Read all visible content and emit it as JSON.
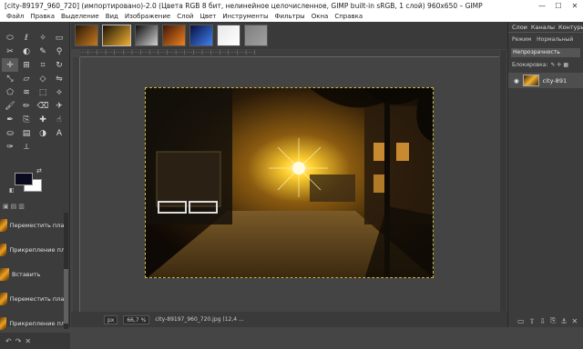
{
  "window": {
    "title": "[city-89197_960_720] (импортировано)-2.0 (Цвета RGB 8 бит, нелинейное целочисленное, GIMP built-in sRGB, 1 слой) 960x650 – GIMP",
    "minimize": "—",
    "maximize": "☐",
    "close": "✕"
  },
  "menu": [
    "Файл",
    "Правка",
    "Выделение",
    "Вид",
    "Изображение",
    "Слой",
    "Цвет",
    "Инструменты",
    "Фильтры",
    "Окна",
    "Справка"
  ],
  "tools": [
    {
      "icon": "ellipse-select-icon",
      "glyph": "⬭"
    },
    {
      "icon": "lasso-icon",
      "glyph": "ℓ"
    },
    {
      "icon": "fuzzy-select-icon",
      "glyph": "✧"
    },
    {
      "icon": "rect-select-icon",
      "glyph": "▭"
    },
    {
      "icon": "scissors-icon",
      "glyph": "✂"
    },
    {
      "icon": "foreground-select-icon",
      "glyph": "◐"
    },
    {
      "icon": "color-picker-icon",
      "glyph": "✎"
    },
    {
      "icon": "zoom-icon",
      "glyph": "⚲"
    },
    {
      "icon": "move-icon",
      "glyph": "✛"
    },
    {
      "icon": "align-icon",
      "glyph": "⊞"
    },
    {
      "icon": "crop-icon",
      "glyph": "⌗"
    },
    {
      "icon": "rotate-icon",
      "glyph": "↻"
    },
    {
      "icon": "scale-icon",
      "glyph": "⤡"
    },
    {
      "icon": "shear-icon",
      "glyph": "▱"
    },
    {
      "icon": "perspective-icon",
      "glyph": "◇"
    },
    {
      "icon": "flip-icon",
      "glyph": "⇋"
    },
    {
      "icon": "cage-icon",
      "glyph": "⬠"
    },
    {
      "icon": "warp-icon",
      "glyph": "≋"
    },
    {
      "icon": "unified-transform-icon",
      "glyph": "⬚"
    },
    {
      "icon": "handle-transform-icon",
      "glyph": "⟡"
    },
    {
      "icon": "paintbrush-icon",
      "glyph": "🖌"
    },
    {
      "icon": "pencil-icon",
      "glyph": "✏"
    },
    {
      "icon": "eraser-icon",
      "glyph": "⌫"
    },
    {
      "icon": "airbrush-icon",
      "glyph": "✈"
    },
    {
      "icon": "ink-icon",
      "glyph": "✒"
    },
    {
      "icon": "clone-icon",
      "glyph": "⎘"
    },
    {
      "icon": "heal-icon",
      "glyph": "✚"
    },
    {
      "icon": "smudge-icon",
      "glyph": "☝"
    },
    {
      "icon": "bucket-fill-icon",
      "glyph": "⛀"
    },
    {
      "icon": "gradient-icon",
      "glyph": "▤"
    },
    {
      "icon": "dodge-icon",
      "glyph": "◑"
    },
    {
      "icon": "text-icon",
      "glyph": "A"
    },
    {
      "icon": "paths-icon",
      "glyph": "✑"
    },
    {
      "icon": "measure-icon",
      "glyph": "⟂"
    }
  ],
  "history_tabs": [
    "▣",
    "▤",
    "▥"
  ],
  "history": [
    {
      "label": "Переместить плавающ"
    },
    {
      "label": "Прикрепление плавающ"
    },
    {
      "label": "Вставить"
    },
    {
      "label": "Переместить плавающ"
    },
    {
      "label": "Прикрепление плавающ"
    }
  ],
  "history_footer": [
    "↶",
    "↷",
    "✕"
  ],
  "image_tabs": [
    {
      "active": false,
      "colors": [
        "#2a1a08",
        "#c87820"
      ]
    },
    {
      "active": true,
      "colors": [
        "#1a1208",
        "#f0b030"
      ]
    },
    {
      "active": false,
      "colors": [
        "#101010",
        "#d0d0d0"
      ]
    },
    {
      "active": false,
      "colors": [
        "#401808",
        "#f08020"
      ]
    },
    {
      "active": false,
      "colors": [
        "#081040",
        "#4080f0"
      ]
    },
    {
      "active": false,
      "colors": [
        "#e8e8e8",
        "#ffffff"
      ]
    },
    {
      "active": false,
      "colors": [
        "#808080",
        "#a0a0a0"
      ]
    }
  ],
  "ruler_marks": "·····|·····|·····|·····|·····|·····|·····|·····|·····|·····|·····|·····|·····|·····|·····|·····|·····|·····|·····|·····|",
  "statusbar": {
    "unit": "px",
    "zoom": "66,7 %",
    "info": "city-89197_960_720.jpg (12,4 ..."
  },
  "dock": {
    "tabs": [
      "Слои",
      "Каналы",
      "Контуры"
    ],
    "mode_label": "Режим",
    "mode_value": "Нормальный",
    "opacity_label": "Непрозрачность",
    "lock_label": "Блокировка:",
    "lock_icons": "✎ ✛ ▦",
    "layer_name": "city-891",
    "footer": [
      "▭",
      "⇧",
      "⇩",
      "⎘",
      "⚓",
      "✕"
    ]
  }
}
